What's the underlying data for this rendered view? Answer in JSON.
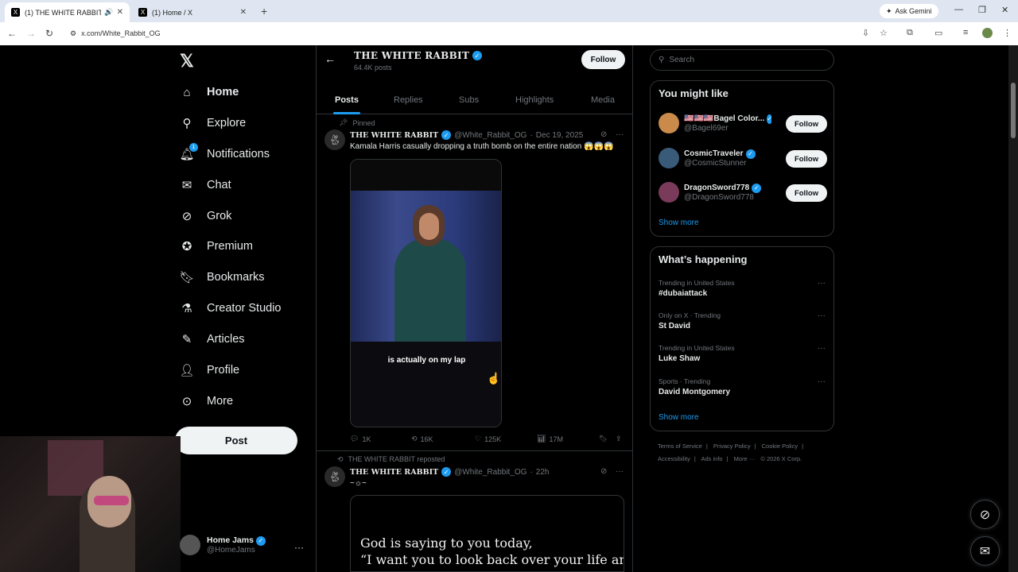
{
  "browser": {
    "tabs": [
      {
        "title": "(1) THE WHITE RABBIT (@",
        "close": "✕"
      },
      {
        "title": "(1) Home / X",
        "close": "✕"
      }
    ],
    "new_tab": "+",
    "ask_gemini": "Ask Gemini",
    "url": "x.com/White_Rabbit_OG"
  },
  "sidebar": {
    "logo": "𝕏",
    "items": [
      {
        "label": "Home",
        "icon": "home-icon"
      },
      {
        "label": "Explore",
        "icon": "search-icon"
      },
      {
        "label": "Notifications",
        "icon": "bell-icon",
        "badge": "1"
      },
      {
        "label": "Chat",
        "icon": "mail-icon"
      },
      {
        "label": "Grok",
        "icon": "grok-icon"
      },
      {
        "label": "Premium",
        "icon": "premium-icon"
      },
      {
        "label": "Bookmarks",
        "icon": "bookmark-icon"
      },
      {
        "label": "Creator Studio",
        "icon": "flask-icon"
      },
      {
        "label": "Articles",
        "icon": "article-icon"
      },
      {
        "label": "Profile",
        "icon": "person-icon"
      },
      {
        "label": "More",
        "icon": "more-icon"
      }
    ],
    "post_label": "Post",
    "account": {
      "name": "Home Jams",
      "handle": "@HomeJams"
    }
  },
  "profile_header": {
    "name": "THE WHITE RABBIT",
    "posts": "64.4K posts",
    "follow_label": "Follow"
  },
  "profile_tabs": [
    "Posts",
    "Replies",
    "Subs",
    "Highlights",
    "Media"
  ],
  "tweets": [
    {
      "context": "Pinned",
      "name": "THE WHITE RABBIT",
      "handle": "@White_Rabbit_OG",
      "time": "Dec 19, 2025",
      "text": "Kamala Harris casually dropping a truth bomb on the entire nation 😱😱😱",
      "video_caption": "is actually on my lap",
      "stats": {
        "replies": "1K",
        "reposts": "16K",
        "likes": "125K",
        "views": "17M"
      }
    },
    {
      "context": "THE WHITE RABBIT reposted",
      "name": "THE WHITE RABBIT",
      "handle": "@White_Rabbit_OG",
      "time": "22h",
      "text": "~☼~",
      "quote_lines": [
        "God is saying to you today,",
        "“I want you to look back over your life and"
      ]
    }
  ],
  "right": {
    "search_placeholder": "Search",
    "who_to_follow": {
      "title": "You might like",
      "accounts": [
        {
          "name": "🇺🇸🇺🇸🇺🇸Bagel Color...",
          "handle": "@Bagel69er",
          "follow": "Follow",
          "color": "#c98a4a"
        },
        {
          "name": "CosmicTraveler",
          "handle": "@CosmicStunner",
          "follow": "Follow",
          "color": "#3a5a7a"
        },
        {
          "name": "DragonSword778",
          "handle": "@DragonSword778",
          "follow": "Follow",
          "color": "#7a3a5a"
        }
      ],
      "show_more": "Show more"
    },
    "happening": {
      "title": "What’s happening",
      "trends": [
        {
          "meta": "Trending in United States",
          "name": "#dubaiattack"
        },
        {
          "meta": "Only on X · Trending",
          "name": "St David"
        },
        {
          "meta": "Trending in United States",
          "name": "Luke Shaw"
        },
        {
          "meta": "Sports · Trending",
          "name": "David Montgomery"
        }
      ],
      "show_more": "Show more"
    },
    "footer": [
      "Terms of Service",
      "|",
      "Privacy Policy",
      "|",
      "Cookie Policy",
      "|",
      "Accessibility",
      "|",
      "Ads info",
      "|",
      "More ···",
      "© 2026 X Corp."
    ]
  }
}
